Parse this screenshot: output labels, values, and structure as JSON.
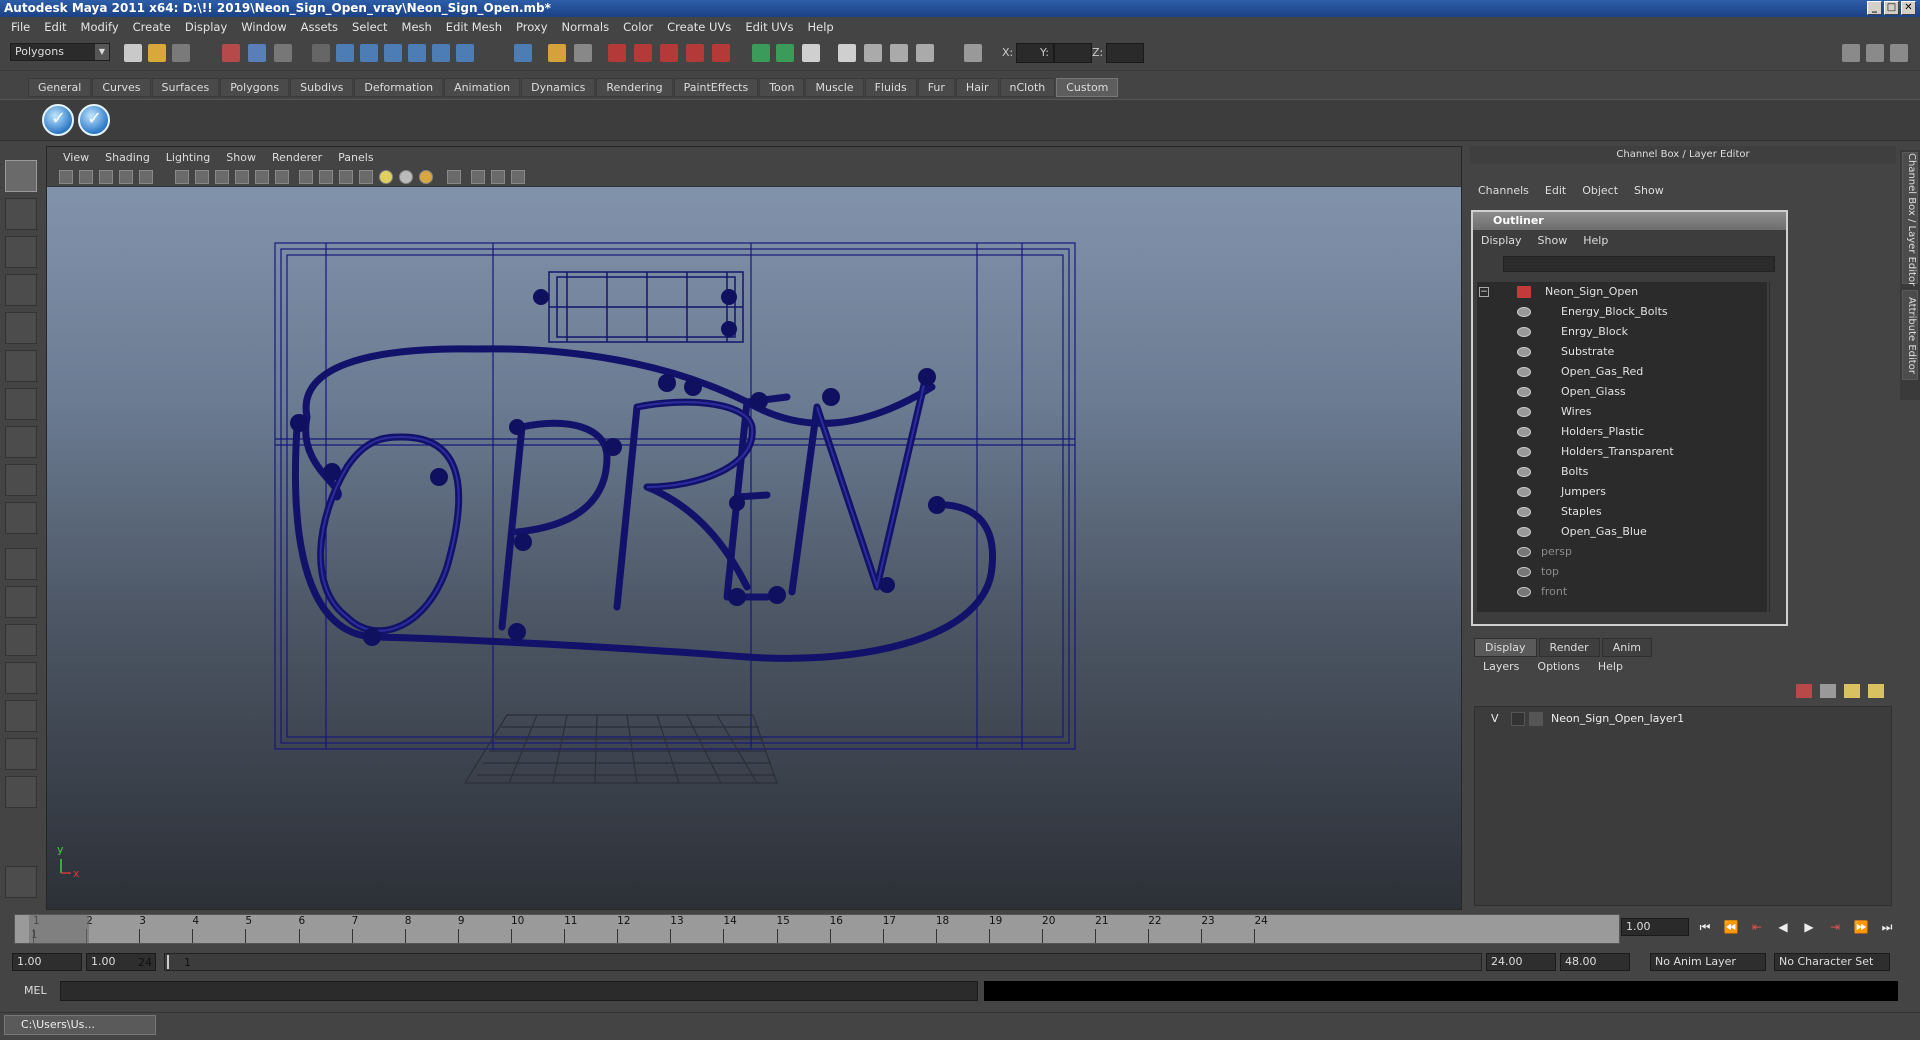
{
  "window": {
    "title": "Autodesk Maya 2011 x64: D:\\!! 2019\\Neon_Sign_Open_vray\\Neon_Sign_Open.mb*",
    "controls": [
      "_",
      "□",
      "✕"
    ]
  },
  "menubar": [
    "File",
    "Edit",
    "Modify",
    "Create",
    "Display",
    "Window",
    "Assets",
    "Select",
    "Mesh",
    "Edit Mesh",
    "Proxy",
    "Normals",
    "Color",
    "Create UVs",
    "Edit UVs",
    "Help"
  ],
  "status": {
    "mode": "Polygons",
    "x_label": "X:",
    "y_label": "Y:",
    "z_label": "Z:"
  },
  "shelf": {
    "tabs": [
      "General",
      "Curves",
      "Surfaces",
      "Polygons",
      "Subdivs",
      "Deformation",
      "Animation",
      "Dynamics",
      "Rendering",
      "PaintEffects",
      "Toon",
      "Muscle",
      "Fluids",
      "Fur",
      "Hair",
      "nCloth",
      "Custom"
    ],
    "active_tab": "Custom",
    "buttons": [
      "✓",
      "✓"
    ]
  },
  "viewport": {
    "menu": [
      "View",
      "Shading",
      "Lighting",
      "Show",
      "Renderer",
      "Panels"
    ],
    "axis_y": "y",
    "axis_x": "x",
    "wire_color": "#16166e"
  },
  "channelbox": {
    "title": "Channel Box / Layer Editor",
    "menu": [
      "Channels",
      "Edit",
      "Object",
      "Show"
    ],
    "side_tabs": [
      "Channel Box / Layer Editor",
      "Attribute Editor"
    ]
  },
  "outliner": {
    "title": "Outliner",
    "menu": [
      "Display",
      "Show",
      "Help"
    ],
    "root": "Neon_Sign_Open",
    "children": [
      "Energy_Block_Bolts",
      "Enrgy_Block",
      "Substrate",
      "Open_Gas_Red",
      "Open_Glass",
      "Wires",
      "Holders_Plastic",
      "Holders_Transparent",
      "Bolts",
      "Jumpers",
      "Staples",
      "Open_Gas_Blue"
    ],
    "cameras": [
      "persp",
      "top",
      "front"
    ]
  },
  "layer_editor": {
    "tabs": [
      "Display",
      "Render",
      "Anim"
    ],
    "active_tab": "Display",
    "menu": [
      "Layers",
      "Options",
      "Help"
    ],
    "layer_visibility": "V",
    "layer_name": "Neon_Sign_Open_layer1"
  },
  "timeslider": {
    "ticks": [
      "1",
      "2",
      "3",
      "4",
      "5",
      "6",
      "7",
      "8",
      "9",
      "10",
      "11",
      "12",
      "13",
      "14",
      "15",
      "16",
      "17",
      "18",
      "19",
      "20",
      "21",
      "22",
      "23",
      "24"
    ],
    "current_marker": "1",
    "current_frame": "1.00"
  },
  "range": {
    "start_time": "1.00",
    "playback_start": "1.00",
    "handle_start": "1",
    "handle_end": "24",
    "playback_end": "24.00",
    "end_time": "48.00",
    "anim_layer": "No Anim Layer",
    "character_set": "No Character Set"
  },
  "cmdline": {
    "label": "MEL"
  },
  "taskbar": {
    "item": "C:\\Users\\Us..."
  }
}
